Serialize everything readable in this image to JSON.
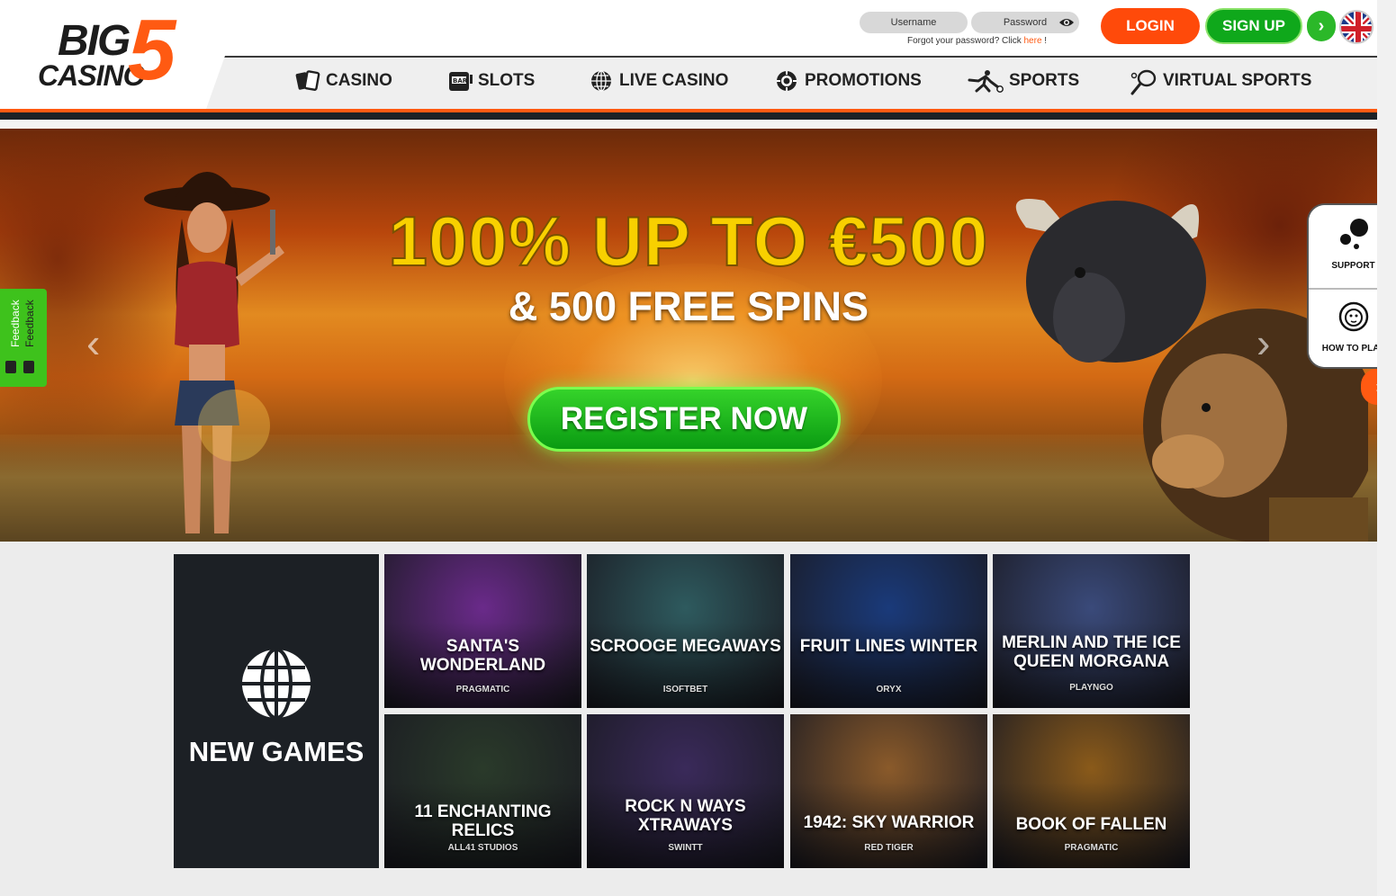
{
  "logo": {
    "big": "BIG",
    "casino": "CASINO",
    "five": "5"
  },
  "login": {
    "username_placeholder": "Username",
    "password_placeholder": "Password",
    "forgot_text": "Forgot your password? Click ",
    "forgot_link": "here",
    "forgot_end": " !",
    "login_label": "LOGIN",
    "signup_label": "SIGN UP",
    "arrow_icon": "chevron-right-icon",
    "flag_icon": "uk-flag-icon"
  },
  "nav": [
    {
      "label": "CASINO",
      "icon": "cards-icon"
    },
    {
      "label": "SLOTS",
      "icon": "slot-machine-icon"
    },
    {
      "label": "LIVE CASINO",
      "icon": "globe-icon"
    },
    {
      "label": "PROMOTIONS",
      "icon": "chip-icon"
    },
    {
      "label": "SPORTS",
      "icon": "football-player-icon"
    },
    {
      "label": "VIRTUAL SPORTS",
      "icon": "racket-icon"
    }
  ],
  "hero": {
    "headline": "100% UP TO €500",
    "subline": "& 500 FREE SPINS",
    "cta": "REGISTER NOW",
    "prev": "‹",
    "next": "›"
  },
  "feedback": {
    "label1": "Feedback",
    "label2": "Feedback"
  },
  "side": {
    "support": "SUPPORT",
    "how_to_play": "HOW TO PLAY",
    "toggle_icon": "chevron-right-icon"
  },
  "games": {
    "section_label": "NEW GAMES",
    "items": [
      {
        "title": "SANTA'S WONDERLAND",
        "provider": "PRAGMATIC",
        "color": "#6a2a8a"
      },
      {
        "title": "SCROOGE MEGAWAYS",
        "provider": "ISOFTBET",
        "color": "#2e5a5e"
      },
      {
        "title": "FRUIT LINES WINTER",
        "provider": "ORYX",
        "color": "#1a3a7a"
      },
      {
        "title": "MERLIN AND THE ICE QUEEN MORGANA",
        "provider": "PLAYNGO",
        "color": "#3a4a7a"
      },
      {
        "title": "11 ENCHANTING RELICS",
        "provider": "ALL41 STUDIOS",
        "color": "#2a3a2a"
      },
      {
        "title": "ROCK N WAYS XTRAWAYS",
        "provider": "SWINTT",
        "color": "#3a2a5a"
      },
      {
        "title": "1942: SKY WARRIOR",
        "provider": "RED TIGER",
        "color": "#8a5a2a"
      },
      {
        "title": "BOOK OF FALLEN",
        "provider": "PRAGMATIC",
        "color": "#8a5a1a"
      }
    ]
  }
}
